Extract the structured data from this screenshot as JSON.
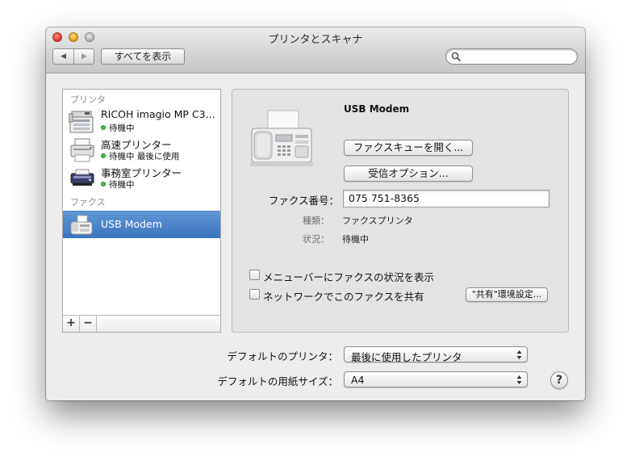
{
  "window": {
    "title": "プリンタとスキャナ"
  },
  "toolbar": {
    "back_label": "◀",
    "forward_label": "▶",
    "show_all_label": "すべてを表示",
    "search_placeholder": ""
  },
  "sidebar": {
    "printers_header": "プリンタ",
    "printers": [
      {
        "name": "RICOH imagio MP C3...",
        "status": "待機中",
        "icon": "copier-printer-icon"
      },
      {
        "name": "高速プリンター",
        "status": "待機中 最後に使用",
        "icon": "printer-icon"
      },
      {
        "name": "事務室プリンター",
        "status": "待機中",
        "icon": "desk-printer-icon"
      }
    ],
    "fax_header": "ファクス",
    "faxes": [
      {
        "name": "USB Modem",
        "selected": true,
        "icon": "fax-icon"
      }
    ],
    "add_label": "+",
    "remove_label": "−"
  },
  "detail": {
    "device_name": "USB Modem",
    "open_queue_label": "ファクスキューを開く...",
    "receive_options_label": "受信オプション...",
    "fax_number_label": "ファクス番号：",
    "fax_number_value": "075 751-8365",
    "kind_label": "種類：",
    "kind_value": "ファクスプリンタ",
    "status_label": "状況：",
    "status_value": "待機中",
    "show_in_menubar_label": "メニューバーにファクスの状況を表示",
    "show_in_menubar_checked": false,
    "share_label": "ネットワークでこのファクスを共有",
    "share_checked": false,
    "sharing_prefs_label": "\"共有\"環境設定..."
  },
  "defaults": {
    "printer_label": "デフォルトのプリンタ：",
    "printer_value": "最後に使用したプリンタ",
    "paper_label": "デフォルトの用紙サイズ：",
    "paper_value": "A4"
  },
  "help_label": "?",
  "colors": {
    "selection": "#3a74bd",
    "status_dot": "#41c03a"
  }
}
